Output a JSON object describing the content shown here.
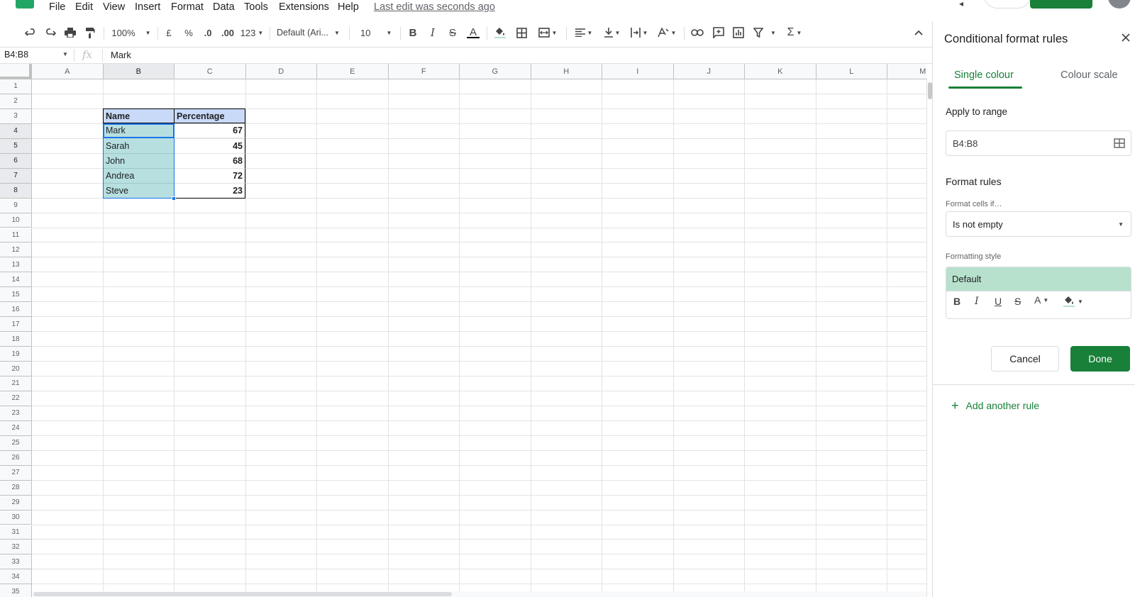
{
  "menu": {
    "items": [
      "File",
      "Edit",
      "View",
      "Insert",
      "Format",
      "Data",
      "Tools",
      "Extensions",
      "Help"
    ],
    "last_edit": "Last edit was seconds ago"
  },
  "toolbar": {
    "zoom": "100%",
    "currency": "£",
    "percent": "%",
    "decrease_decimal": ".0",
    "increase_decimal": ".00",
    "number_format": "123",
    "font": "Default (Ari...",
    "font_size": "10"
  },
  "formula_bar": {
    "name_box": "B4:B8",
    "fx": "fx",
    "value": "Mark"
  },
  "grid": {
    "columns": [
      "A",
      "B",
      "C",
      "D",
      "E",
      "F",
      "G",
      "H",
      "I",
      "J",
      "K",
      "L",
      "M"
    ],
    "rows": [
      "1",
      "2",
      "3",
      "4",
      "5",
      "6",
      "7",
      "8",
      "9",
      "10",
      "11",
      "12",
      "13",
      "14",
      "15",
      "16",
      "17",
      "18",
      "19",
      "20",
      "21",
      "22",
      "23",
      "24",
      "25",
      "26",
      "27",
      "28",
      "29",
      "30",
      "31",
      "32",
      "33",
      "34",
      "35"
    ],
    "table": {
      "headers": [
        "Name",
        "Percentage"
      ],
      "rows": [
        {
          "name": "Mark",
          "value": "67"
        },
        {
          "name": "Sarah",
          "value": "45"
        },
        {
          "name": "John",
          "value": "68"
        },
        {
          "name": "Andrea",
          "value": "72"
        },
        {
          "name": "Steve",
          "value": "23"
        }
      ]
    },
    "header_fill": "#c9daf8",
    "highlight_fill": "#b7dfe0"
  },
  "panel": {
    "title": "Conditional format rules",
    "tabs": [
      "Single colour",
      "Colour scale"
    ],
    "active_tab": "Single colour",
    "apply_to_range_label": "Apply to range",
    "range_value": "B4:B8",
    "format_rules_label": "Format rules",
    "format_cells_if_label": "Format cells if…",
    "condition": "Is not empty",
    "formatting_style_label": "Formatting style",
    "style_preview": "Default",
    "style_fill": "#b7e1cd",
    "format_buttons": [
      "B",
      "I",
      "U",
      "S",
      "A"
    ],
    "cancel": "Cancel",
    "done": "Done",
    "add_rule": "Add another rule",
    "accent": "#188038"
  }
}
